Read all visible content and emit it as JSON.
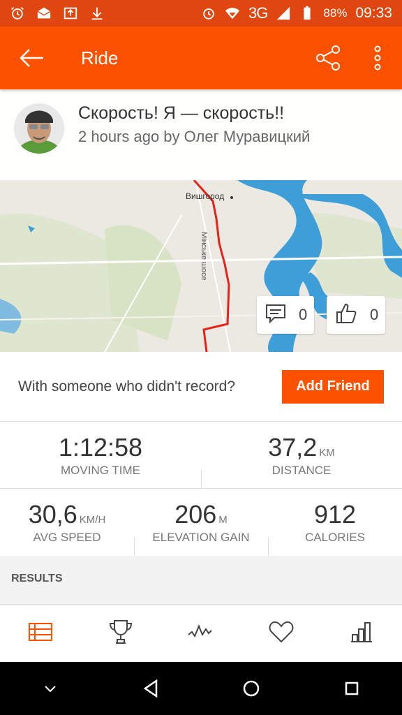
{
  "status_bar": {
    "network": "3G",
    "battery": "88%",
    "time": "09:33",
    "icons_left": [
      "alarm-icon",
      "mail-icon",
      "upload-icon",
      "download-icon"
    ],
    "icons_right": [
      "alarm-icon",
      "wifi-icon",
      "signal-icon",
      "battery-icon"
    ]
  },
  "appbar": {
    "title": "Ride",
    "color": "#fc5200",
    "icons": [
      "back-arrow-icon",
      "share-icon",
      "more-vertical-icon"
    ]
  },
  "activity": {
    "title": "Скорость! Я — скорость!!",
    "meta": "2 hours ago by Олег Муравицкий"
  },
  "map": {
    "city_label": "Вишгород",
    "road_label": "Мінське шосе",
    "comments": "0",
    "kudos": "0"
  },
  "friend": {
    "prompt": "With someone who didn't record?",
    "button": "Add Friend"
  },
  "stats": {
    "moving_time": {
      "value": "1:12:58",
      "label": "MOVING TIME"
    },
    "distance": {
      "value": "37,2",
      "unit": "KM",
      "label": "DISTANCE"
    },
    "avg_speed": {
      "value": "30,6",
      "unit": "KM/H",
      "label": "AVG SPEED"
    },
    "elevation": {
      "value": "206",
      "unit": "M",
      "label": "ELEVATION GAIN"
    },
    "calories": {
      "value": "912",
      "label": "CALORIES"
    }
  },
  "results": {
    "label": "RESULTS"
  },
  "tabs": [
    "list-icon",
    "trophy-icon",
    "analysis-icon",
    "heart-icon",
    "bar-chart-icon"
  ],
  "navbar": [
    "collapse-icon",
    "back-icon",
    "home-icon",
    "recents-icon"
  ]
}
